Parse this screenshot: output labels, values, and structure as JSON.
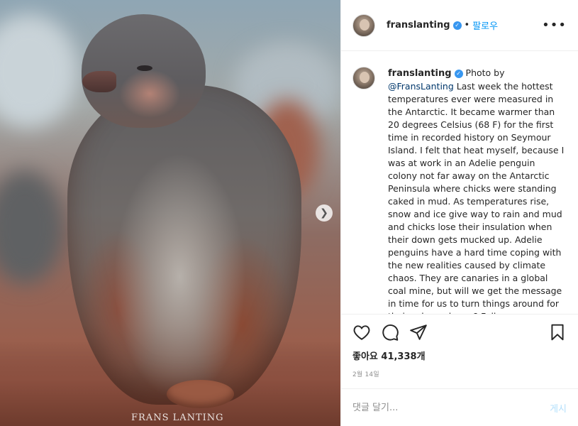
{
  "post": {
    "username": "franslanting",
    "follow_label": "팔로우",
    "separator": "•",
    "more_label": "•••",
    "watermark": "FRANS LANTING",
    "caption_prefix": "Photo by",
    "caption_mention": "@FransLanting",
    "caption_text": "Last week the hottest temperatures ever were measured in the Antarctic. It became warmer than 20 degrees Celsius (68 F) for the first time in recorded history on Seymour Island. I felt that heat myself, because I was at work in an Adelie penguin colony not far away on the Antarctic Peninsula where chicks were standing caked in mud. As temperatures rise, snow and ice give way to rain and mud and chicks lose their insulation when their down gets mucked up. Adelie penguins have a hard time coping with the new realities caused by climate chaos. They are canaries in a global coal mine, but will we get the message in time for us to turn things around for their sake and ours? Follow",
    "likes_label": "좋아요 41,338개",
    "date": "2월 14일",
    "comment_placeholder": "댓글 달기...",
    "post_label": "게시",
    "icons": [
      "heart-icon",
      "comment-icon",
      "share-icon",
      "bookmark-icon",
      "chevron-right-icon",
      "verified-icon"
    ]
  },
  "colors": {
    "accent": "#0095f6",
    "verified": "#3897f0",
    "post_disabled": "#b2dffc"
  }
}
